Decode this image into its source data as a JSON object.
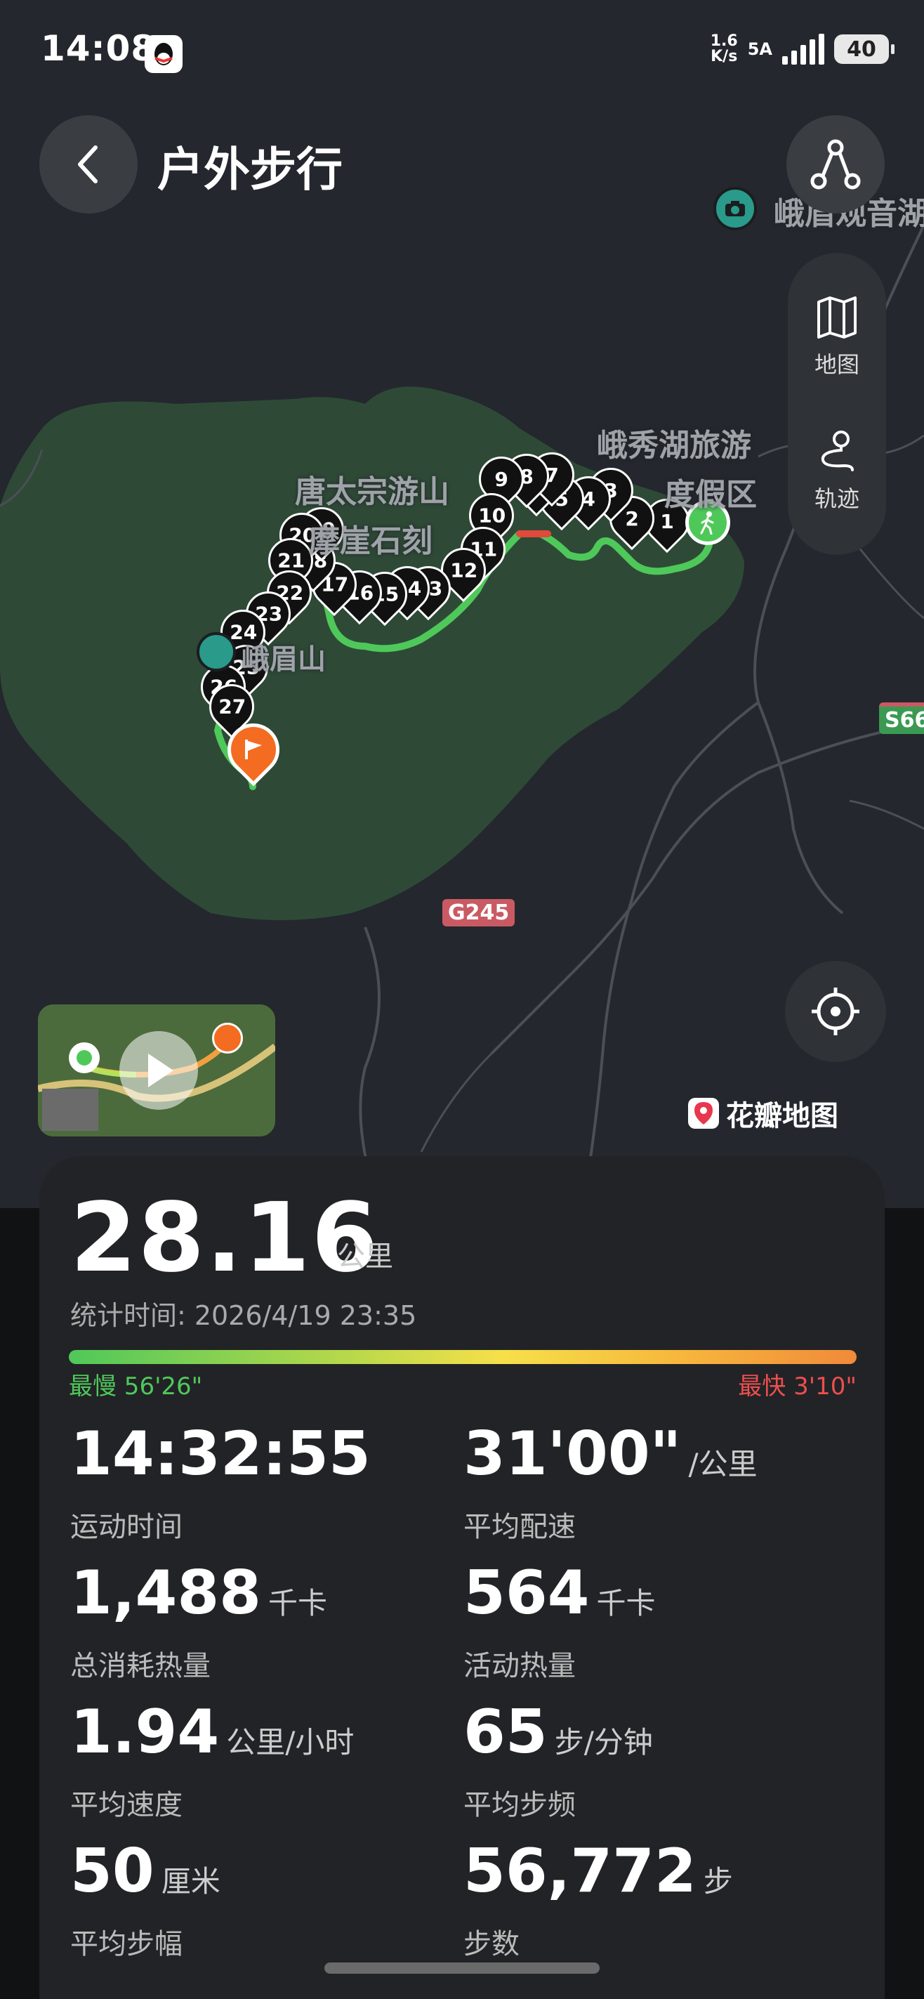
{
  "status": {
    "time": "14:08",
    "net_speed": "1.6",
    "net_unit": "K/s",
    "network": "5A",
    "battery": "40"
  },
  "header": {
    "title": "户外步行"
  },
  "map": {
    "labels": [
      "峨眉观音湖",
      "唐太宗游山",
      "摩崖石刻",
      "峨秀湖旅游",
      "度假区",
      "峨眉山"
    ],
    "roads": [
      "G245",
      "S66"
    ],
    "markers": [
      "1",
      "2",
      "3",
      "4",
      "5",
      "6",
      "7",
      "8",
      "9",
      "10",
      "11",
      "12",
      "13",
      "14",
      "15",
      "16",
      "17",
      "18",
      "19",
      "20",
      "21",
      "22",
      "23",
      "24",
      "25",
      "26",
      "27"
    ],
    "side_panel": {
      "map_label": "地图",
      "track_label": "轨迹"
    },
    "brand": "花瓣地图"
  },
  "summary": {
    "distance": "28.16",
    "distance_unit": "公里",
    "time_label": "统计时间:",
    "time_value": "2026/4/19 23:35",
    "slowest": "最慢 56'26\"",
    "fastest": "最快 3'10\""
  },
  "metrics": [
    {
      "value": "14:32:55",
      "unit": "",
      "label": "运动时间"
    },
    {
      "value": "31'00\"",
      "unit": "/公里",
      "label": "平均配速"
    },
    {
      "value": "1,488",
      "unit": "千卡",
      "label": "总消耗热量"
    },
    {
      "value": "564",
      "unit": "千卡",
      "label": "活动热量"
    },
    {
      "value": "1.94",
      "unit": "公里/小时",
      "label": "平均速度"
    },
    {
      "value": "65",
      "unit": "步/分钟",
      "label": "平均步频"
    },
    {
      "value": "50",
      "unit": "厘米",
      "label": "平均步幅"
    },
    {
      "value": "56,772",
      "unit": "步",
      "label": "步数"
    }
  ],
  "colors": {
    "route_green": "#4fc85a",
    "finish_orange": "#f36c21",
    "fast_red": "#ec4f4f"
  }
}
